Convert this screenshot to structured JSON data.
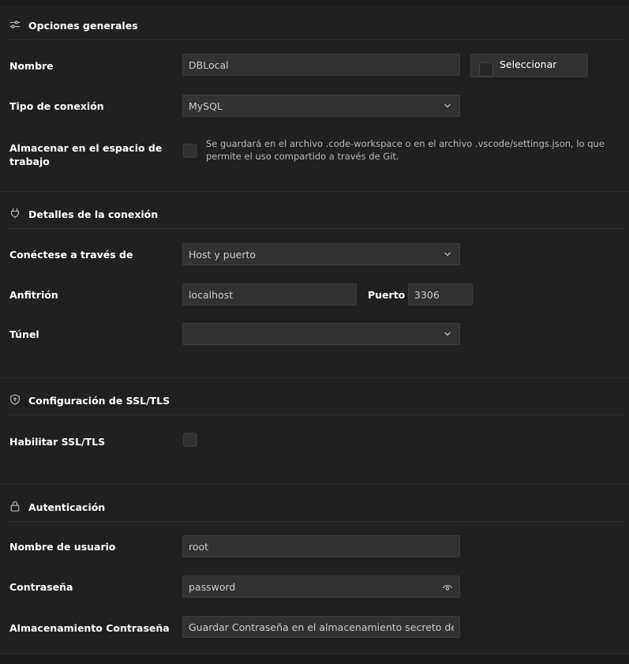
{
  "general": {
    "title": "Opciones generales",
    "name_label": "Nombre",
    "name_value": "DBLocal",
    "select_button": "Seleccionar",
    "conn_type_label": "Tipo de conexión",
    "conn_type_value": "MySQL",
    "workspace_label_line1": "Almacenar en el espacio de",
    "workspace_label_line2": "trabajo",
    "workspace_note": "Se guardará en el archivo .code-workspace o en el archivo .vscode/settings.json, lo que permite el uso compartido a través de Git."
  },
  "connection": {
    "title": "Detalles de la conexión",
    "connect_via_label": "Conéctese a través de",
    "connect_via_value": "Host y puerto",
    "host_label": "Anfitrión",
    "host_value": "localhost",
    "port_label": "Puerto",
    "port_value": "3306",
    "tunnel_label": "Túnel",
    "tunnel_value": ""
  },
  "ssl": {
    "title": "Configuración de SSL/TLS",
    "enable_label": "Habilitar SSL/TLS"
  },
  "auth": {
    "title": "Autenticación",
    "username_label": "Nombre de usuario",
    "username_value": "root",
    "password_label": "Contraseña",
    "password_value": "password",
    "storage_label": "Almacenamiento Contraseña",
    "storage_value": "Guardar Contraseña en el almacenamiento secreto de"
  },
  "icons": {
    "general": "sliders-icon",
    "connection": "plug-icon",
    "ssl": "shield-icon",
    "auth": "lock-icon",
    "chevron": "chevron-down-icon",
    "eye": "eye-icon"
  },
  "colors": {
    "background": "#1f1f1f",
    "field_bg": "#313131",
    "border": "#3c3c3c",
    "text": "#cccccc",
    "label": "#ffffff"
  }
}
